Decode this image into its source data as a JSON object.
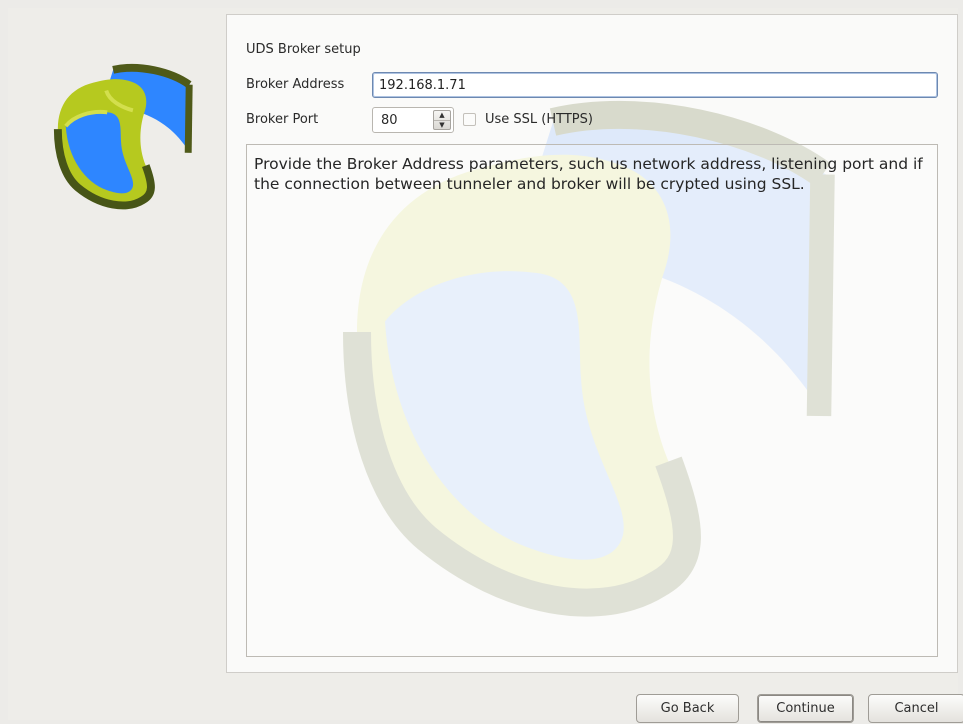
{
  "page": {
    "section_title": "UDS Broker setup"
  },
  "broker": {
    "address_label": "Broker Address",
    "address_value": "192.168.1.71",
    "port_label": "Broker Port",
    "port_value": "80",
    "ssl_label": "Use SSL (HTTPS)",
    "ssl_checked": false
  },
  "info": {
    "text": "Provide the Broker Address parameters, such us network address, listening port and if the connection between tunneler and broker will be crypted using SSL."
  },
  "buttons": {
    "back": "Go Back",
    "continue": "Continue",
    "cancel": "Cancel"
  },
  "icons": {
    "logo": "uds-logo-icon",
    "spin_up": "spin-up-icon",
    "spin_down": "spin-down-icon",
    "watermark": "uds-watermark-icon"
  },
  "colors": {
    "logo_green": "#b6c91f",
    "logo_blue": "#2e7fff",
    "logo_dark": "#4f5a19",
    "focus_border": "#6d88b0"
  }
}
